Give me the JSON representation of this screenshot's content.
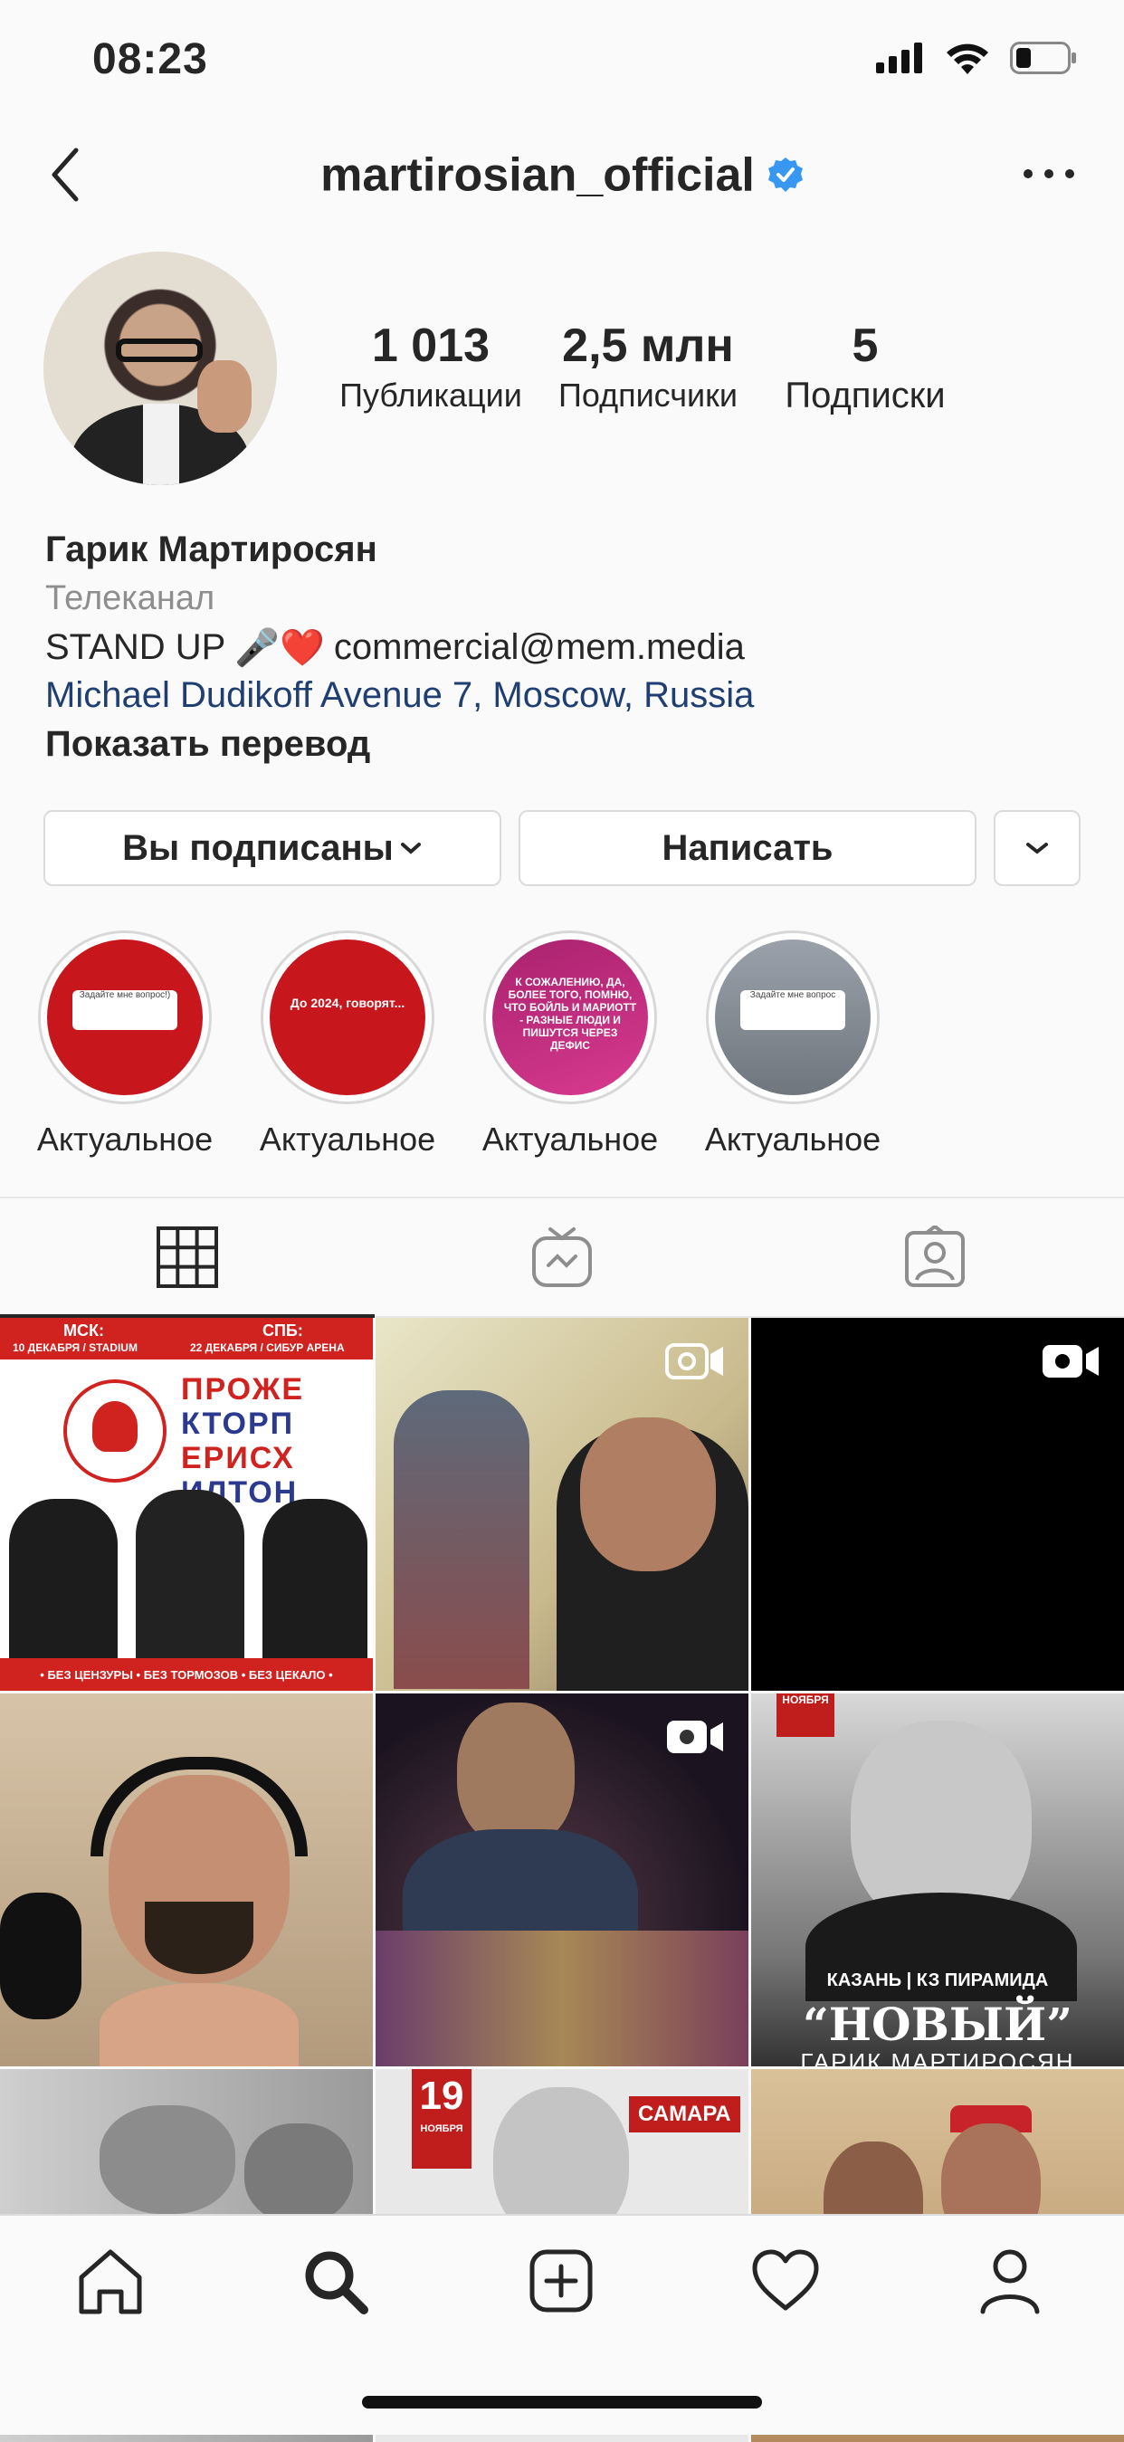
{
  "status_bar": {
    "time": "08:23"
  },
  "header": {
    "username": "martirosian_official"
  },
  "stats": {
    "posts": {
      "value": "1 013",
      "label": "Публикации"
    },
    "followers": {
      "value": "2,5 млн",
      "label": "Подписчики"
    },
    "following": {
      "value": "5",
      "label": "Подписки"
    }
  },
  "bio": {
    "name": "Гарик Мартиросян",
    "category": "Телеканал",
    "line_prefix": "STAND UP",
    "line_emojis": "🎤❤️",
    "email": "commercial@mem.media",
    "address": "Michael Dudikoff Avenue 7, Moscow, Russia",
    "translate": "Показать перевод"
  },
  "buttons": {
    "following": "Вы подписаны",
    "message": "Написать"
  },
  "highlights": [
    {
      "label": "Актуальное",
      "card_text": "Задайте мне вопрос!)",
      "color": "#c8161d"
    },
    {
      "label": "Актуальное",
      "card_text": "До 2024, говорят...",
      "color": "#c8161d"
    },
    {
      "label": "Актуальное",
      "card_text": "К СОЖАЛЕНИЮ, ДА, БОЛЕЕ ТОГО, ПОМНЮ, ЧТО БОЙЛЬ И МАРИОТТ - РАЗНЫЕ ЛЮДИ И ПИШУТСЯ ЧЕРЕЗ ДЕФИС",
      "color": "#b8287a"
    },
    {
      "label": "Актуальное",
      "card_text": "Задайте мне вопрос",
      "color": "#8e949c"
    }
  ],
  "grid": {
    "tile1": {
      "city1": "МСК:",
      "date1": "10 ДЕКАБРЯ / STADIUM",
      "city2": "СПБ:",
      "date2": "22 ДЕКАБРЯ / СИБУР АРЕНА",
      "title_lines": [
        "ПРОЖЕ",
        "КТОРП",
        "ЕРИСХ",
        "ИЛТОН"
      ],
      "footer": "• БЕЗ ЦЕНЗУРЫ • БЕЗ ТОРМОЗОВ • БЕЗ ЦЕКАЛО •"
    },
    "tile6": {
      "ribbon": "НОЯБРЯ",
      "venue": "КАЗАНЬ | КЗ ПИРАМИДА",
      "title": "“НОВЫЙ”",
      "subtitle": "ГАРИК МАРТИРОСЯН"
    },
    "tile8": {
      "day": "19",
      "month": "НОЯБРЯ",
      "city": "САМАРА"
    }
  },
  "colors": {
    "accent_red": "#d0231f",
    "link_blue": "#1f3f73",
    "verified_blue": "#3897f0"
  }
}
